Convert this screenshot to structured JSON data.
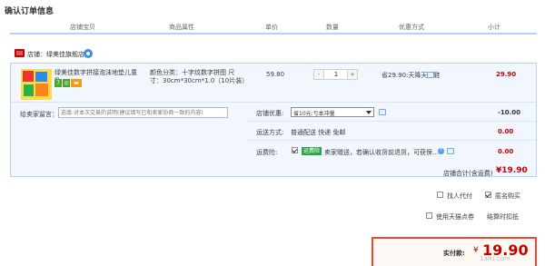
{
  "page": {
    "title": "确认订单信息"
  },
  "table_header": {
    "columns": [
      "店铺宝贝",
      "商品属性",
      "单价",
      "数量",
      "优惠方式",
      "小计"
    ]
  },
  "shop": {
    "label": "店铺：",
    "name": "绿美佳旗舰店"
  },
  "item": {
    "title": "绿美佳数字拼接泡沫地垫儿童卧...",
    "badges": [
      "7",
      "◎",
      "▬"
    ],
    "props": "颜色分类：十字纹数字拼图 尺寸：30cm*30cm*1.0（10片装）",
    "unit_price": "59.80",
    "quantity": {
      "minus": "-",
      "value": "1",
      "plus": "+"
    },
    "promo": "省29.90:天降天甲鞋",
    "subtotal": "29.90"
  },
  "message": {
    "label": "给卖家留言：",
    "placeholder": "选填:对本次交易的说明(建议填写已和卖家协商一致的内容)"
  },
  "coupon": {
    "label": "店铺优惠:",
    "selected": "省10元:亏本冲量",
    "amount": "-10.00"
  },
  "shipping": {
    "label": "运送方式:",
    "value": "普通配送 快递 免邮",
    "amount": "0.00"
  },
  "freight_insurance": {
    "label": "运费险:",
    "tag": "运费险",
    "description": "卖家赠送，若确认收货前退货，可获保...",
    "amount": "0.00"
  },
  "shop_total": {
    "label": "店铺合计(含运费)",
    "value": "¥19.90"
  },
  "options": {
    "proxy_pay": "找人代付",
    "anonymous": "匿名购买",
    "tmall_points": "使用天猫点券",
    "points_deduct": "结算时扣抵"
  },
  "payment": {
    "label": "实付款:",
    "currency": "¥",
    "amount": "19.90"
  },
  "watermark": "1aiki.com"
}
